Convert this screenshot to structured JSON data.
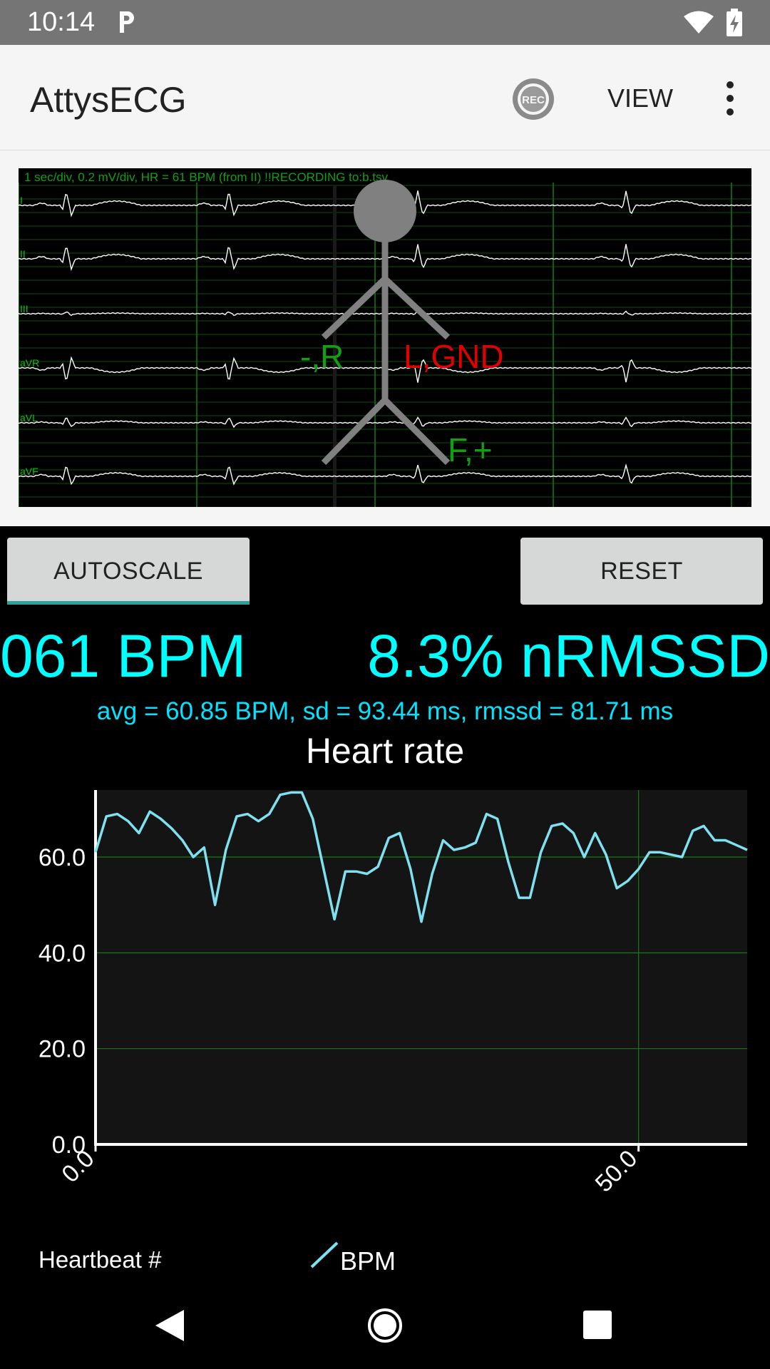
{
  "status_bar": {
    "time": "10:14",
    "icons": [
      "parking-icon",
      "wifi-icon",
      "battery-charging-icon"
    ]
  },
  "app_bar": {
    "title": "AttysECG",
    "rec_label": "REC",
    "view_label": "VIEW",
    "more_icon": "more-vert-icon"
  },
  "ecg": {
    "header": "1 sec/div, 0.2 mV/div, HR = 61 BPM (from II) !!RECORDING to:b.tsv",
    "leads": [
      "I",
      "II",
      "III",
      "aVR",
      "aVL",
      "aVF"
    ],
    "electrodes": {
      "right": "-,R",
      "left": "L,GND",
      "foot": "F,+"
    },
    "colors": {
      "trace": "#ffffff",
      "grid": "#0a6b0a",
      "label_green": "#12a012",
      "label_red": "#e00000"
    }
  },
  "buttons": {
    "autoscale": "AUTOSCALE",
    "reset": "RESET"
  },
  "readouts": {
    "bpm": "061 BPM",
    "nrmssd": "8.3% nRMSSD",
    "stats": "avg = 60.85 BPM, sd = 93.44 ms, rmssd = 81.71 ms"
  },
  "chart_data": {
    "type": "line",
    "title": "Heart rate",
    "xlabel": "Heartbeat #",
    "ylabel": "",
    "x_ticks": [
      "0.0",
      "50.0"
    ],
    "y_ticks": [
      "0.0",
      "20.0",
      "40.0",
      "60.0"
    ],
    "xlim": [
      0,
      60
    ],
    "ylim": [
      0,
      74
    ],
    "grid": true,
    "legend": "bottom",
    "series": [
      {
        "name": "BPM",
        "color": "#7fe0f0",
        "x": [
          0,
          1,
          2,
          3,
          4,
          5,
          6,
          7,
          8,
          9,
          10,
          11,
          12,
          13,
          14,
          15,
          16,
          17,
          18,
          19,
          20,
          21,
          22,
          23,
          24,
          25,
          26,
          27,
          28,
          29,
          30,
          31,
          32,
          33,
          34,
          35,
          36,
          37,
          38,
          39,
          40,
          41,
          42,
          43,
          44,
          45,
          46,
          47,
          48,
          49,
          50,
          51,
          52,
          53,
          54,
          55,
          56,
          57,
          58,
          59,
          60
        ],
        "values": [
          61,
          68.5,
          69,
          67.5,
          65,
          69.5,
          68,
          66,
          63.5,
          60,
          62,
          50,
          61.5,
          68.5,
          69,
          67.5,
          69,
          73,
          73.5,
          73.5,
          68,
          57.5,
          47,
          57,
          57,
          56.5,
          58,
          64,
          65,
          57.5,
          46.5,
          56.5,
          63.5,
          61.5,
          62,
          63,
          69,
          68,
          59,
          51.5,
          51.5,
          61,
          66.5,
          67,
          65,
          60,
          65,
          60.5,
          53.5,
          55,
          57.5,
          61,
          61,
          60.5,
          60,
          65.5,
          66.5,
          63.5,
          63.5,
          62.5,
          61.5
        ]
      }
    ]
  }
}
